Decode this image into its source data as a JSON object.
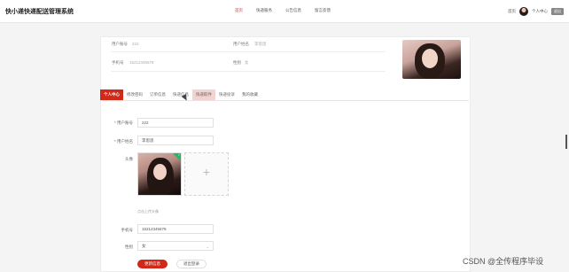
{
  "header": {
    "brand": "快小递快递配送管理系统",
    "nav": [
      "首页",
      "快递服务",
      "公告信息",
      "留言反馈"
    ],
    "active_nav": "首页",
    "right": {
      "home_link": "首页",
      "center_link": "个人中心",
      "logout": "退出"
    }
  },
  "profile": {
    "account_label": "用户账号",
    "account_value": "222",
    "name_label": "用户姓名",
    "name_value": "李思思",
    "phone_label": "手机号",
    "phone_value": "15212345678",
    "gender_label": "性别",
    "gender_value": "女"
  },
  "tabs": [
    "个人中心",
    "修改密码",
    "订单信息",
    "快递信息",
    "快递取件",
    "快递投诉",
    "我的收藏"
  ],
  "tabs_state": {
    "active_index": 0,
    "hover_index": 4
  },
  "form": {
    "account_label": "用户账号",
    "account_value": "222",
    "name_label": "用户姓名",
    "name_value": "李思思",
    "avatar_label": "头像",
    "upload_hint": "点击上传头像",
    "phone_label": "手机号",
    "phone_value": "15212345678",
    "gender_label": "性别",
    "gender_value": "女",
    "submit_label": "更新信息",
    "logout_label": "退出登录"
  },
  "watermark": "CSDN @全传程序毕设",
  "colors": {
    "accent": "#d0291a",
    "success": "#28b463"
  },
  "icons": {
    "upload_add": "plus-icon",
    "upload_done": "check-icon"
  }
}
